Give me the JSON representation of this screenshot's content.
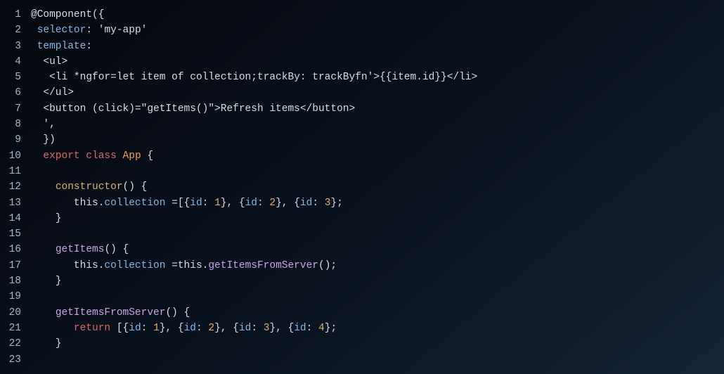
{
  "lineCount": 23,
  "code": {
    "l1": [
      [
        "c-default",
        "@Component({"
      ]
    ],
    "l2": [
      [
        "c-default",
        " "
      ],
      [
        "c-prop",
        "selector"
      ],
      [
        "c-default",
        ": 'my-app'"
      ]
    ],
    "l3": [
      [
        "c-default",
        " "
      ],
      [
        "c-prop",
        "template"
      ],
      [
        "c-default",
        ":"
      ]
    ],
    "l4": [
      [
        "c-default",
        "  <ul>"
      ]
    ],
    "l5": [
      [
        "c-default",
        "   <li *ngfor=let item of collection;trackBy: trackByfn'>{{item.id}}</li>"
      ]
    ],
    "l6": [
      [
        "c-default",
        "  </ul>"
      ]
    ],
    "l7": [
      [
        "c-default",
        "  <button (click)=\"getItems()\">Refresh items</button>"
      ]
    ],
    "l8": [
      [
        "c-default",
        "  ',"
      ]
    ],
    "l9": [
      [
        "c-default",
        "  })"
      ]
    ],
    "l10": [
      [
        "c-default",
        "  "
      ],
      [
        "c-key",
        "export"
      ],
      [
        "c-default",
        " "
      ],
      [
        "c-key",
        "class"
      ],
      [
        "c-default",
        " "
      ],
      [
        "c-type",
        "App"
      ],
      [
        "c-default",
        " {"
      ]
    ],
    "l11": [
      [
        "c-default",
        ""
      ]
    ],
    "l12": [
      [
        "c-default",
        "    "
      ],
      [
        "c-num",
        "constructor"
      ],
      [
        "c-default",
        "() {"
      ]
    ],
    "l13": [
      [
        "c-default",
        "       this."
      ],
      [
        "c-prop",
        "collection"
      ],
      [
        "c-default",
        " =[{"
      ],
      [
        "c-prop",
        "id"
      ],
      [
        "c-default",
        ": "
      ],
      [
        "c-num",
        "1"
      ],
      [
        "c-default",
        "}, {"
      ],
      [
        "c-prop",
        "id"
      ],
      [
        "c-default",
        ": "
      ],
      [
        "c-num",
        "2"
      ],
      [
        "c-default",
        "}, {"
      ],
      [
        "c-prop",
        "id"
      ],
      [
        "c-default",
        ": "
      ],
      [
        "c-num",
        "3"
      ],
      [
        "c-default",
        "};"
      ]
    ],
    "l14": [
      [
        "c-default",
        "    }"
      ]
    ],
    "l15": [
      [
        "c-default",
        ""
      ]
    ],
    "l16": [
      [
        "c-default",
        "    "
      ],
      [
        "c-fn",
        "getItems"
      ],
      [
        "c-default",
        "() {"
      ]
    ],
    "l17": [
      [
        "c-default",
        "       this."
      ],
      [
        "c-prop",
        "collection"
      ],
      [
        "c-default",
        " =this."
      ],
      [
        "c-fn",
        "getItemsFromServer"
      ],
      [
        "c-default",
        "();"
      ]
    ],
    "l18": [
      [
        "c-default",
        "    }"
      ]
    ],
    "l19": [
      [
        "c-default",
        ""
      ]
    ],
    "l20": [
      [
        "c-default",
        "    "
      ],
      [
        "c-fn",
        "getItemsFromServer"
      ],
      [
        "c-default",
        "() {"
      ]
    ],
    "l21": [
      [
        "c-default",
        "       "
      ],
      [
        "c-key",
        "return"
      ],
      [
        "c-default",
        " [{"
      ],
      [
        "c-prop",
        "id"
      ],
      [
        "c-default",
        ": "
      ],
      [
        "c-num",
        "1"
      ],
      [
        "c-default",
        "}, {"
      ],
      [
        "c-prop",
        "id"
      ],
      [
        "c-default",
        ": "
      ],
      [
        "c-num",
        "2"
      ],
      [
        "c-default",
        "}, {"
      ],
      [
        "c-prop",
        "id"
      ],
      [
        "c-default",
        ": "
      ],
      [
        "c-num",
        "3"
      ],
      [
        "c-default",
        "}, {"
      ],
      [
        "c-prop",
        "id"
      ],
      [
        "c-default",
        ": "
      ],
      [
        "c-num",
        "4"
      ],
      [
        "c-default",
        "};"
      ]
    ],
    "l22": [
      [
        "c-default",
        "    }"
      ]
    ],
    "l23": [
      [
        "c-default",
        ""
      ]
    ]
  }
}
